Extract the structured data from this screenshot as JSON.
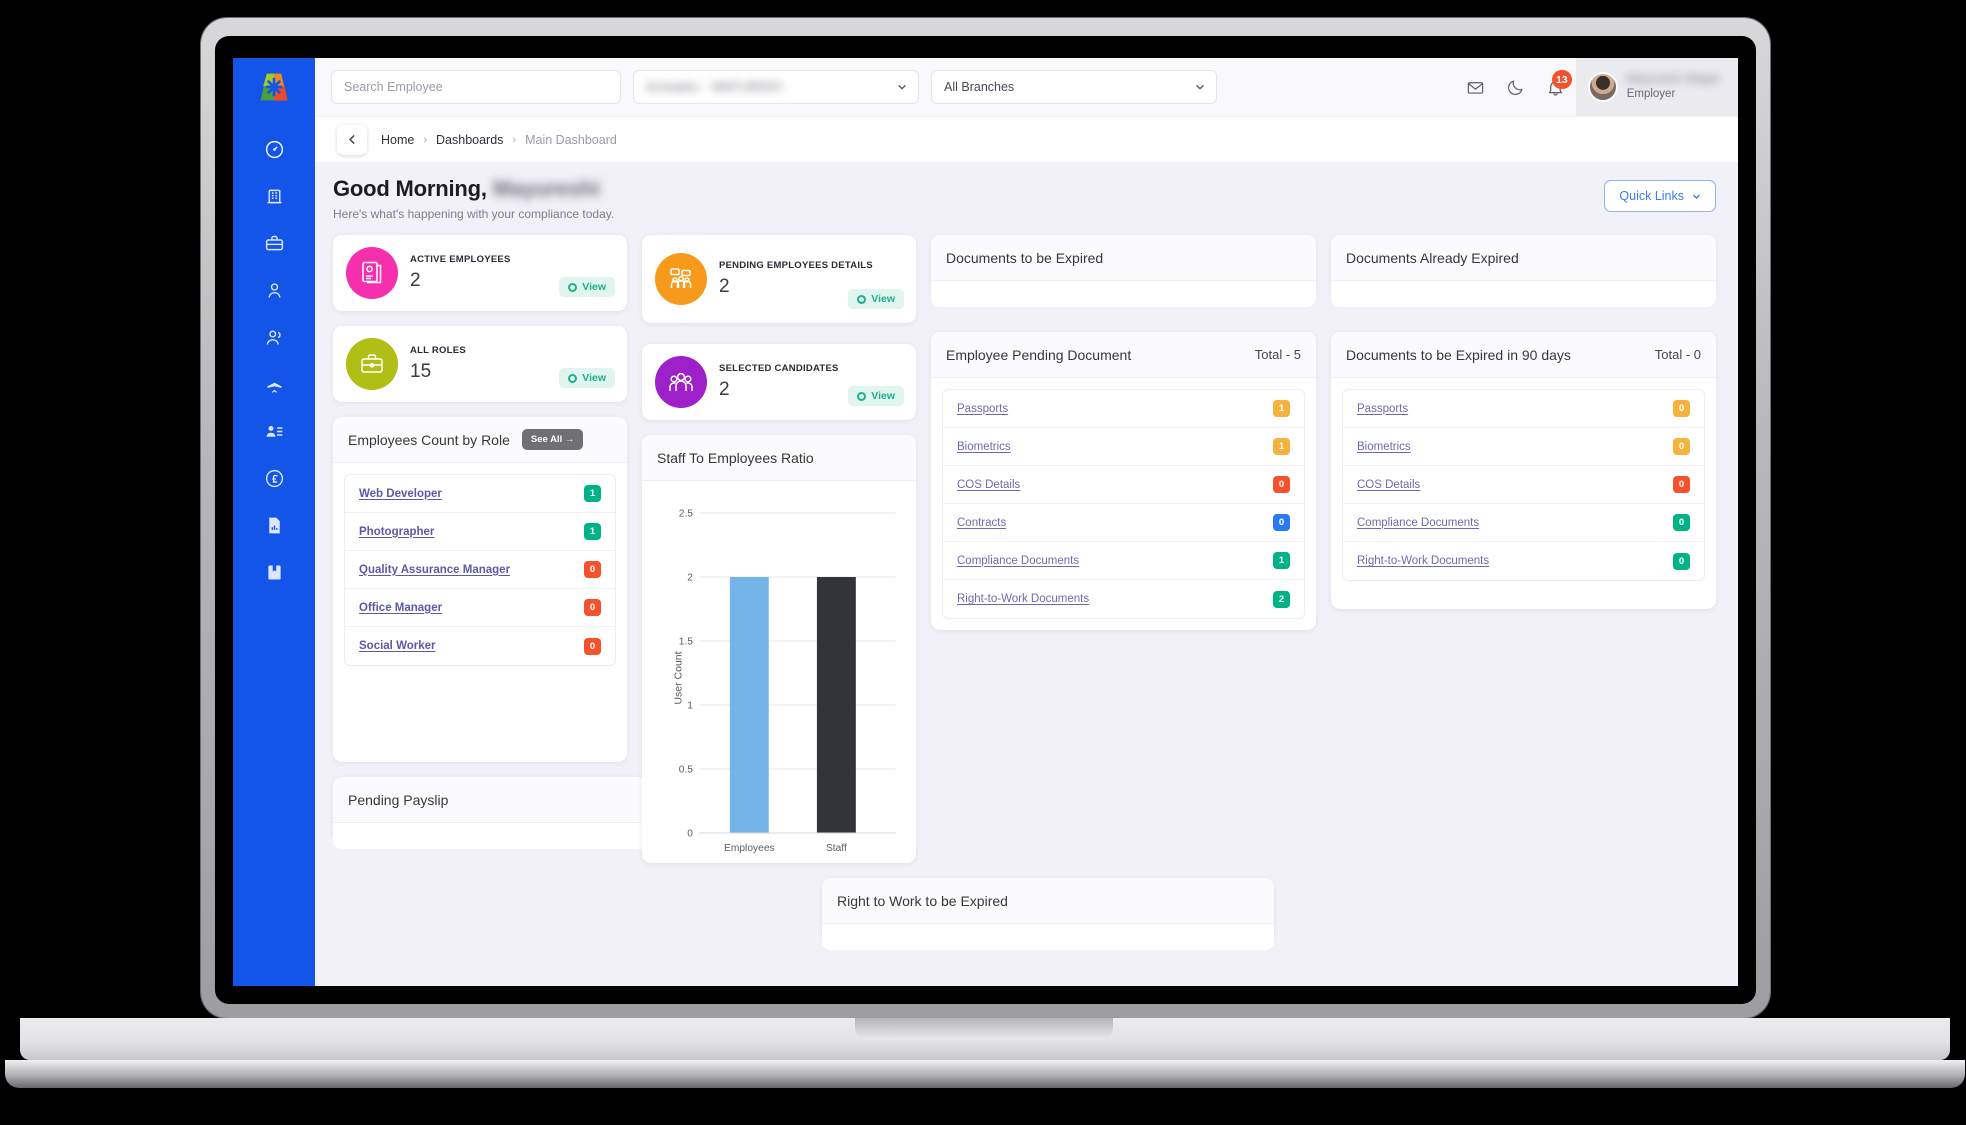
{
  "brand": {
    "logo_name": "app-logo",
    "sidebar_color": "#1355e9"
  },
  "topbar": {
    "search_placeholder": "Search Employee",
    "company_select": "Armadev - WATURDIH",
    "branch_select": "All Branches",
    "notification_count": "13",
    "user_name": "Mayureshi Wagar",
    "user_role": "Employer"
  },
  "breadcrumb": {
    "home": "Home",
    "section": "Dashboards",
    "current": "Main Dashboard",
    "sep": "›"
  },
  "greeting": {
    "salutation": "Good Morning,",
    "name": "Mayureshi",
    "subtitle": "Here's what's happening with your compliance today."
  },
  "quick_links": {
    "label": "Quick Links"
  },
  "stats": [
    {
      "label": "ACTIVE EMPLOYEES",
      "value": "2",
      "view": "View",
      "color": "#f62fae",
      "icon": "id-card-icon"
    },
    {
      "label": "PENDING EMPLOYEES DETAILS",
      "value": "2",
      "view": "View",
      "color": "#f79a1c",
      "icon": "meeting-icon"
    },
    {
      "label": "ALL ROLES",
      "value": "15",
      "view": "View",
      "color": "#b0bf15",
      "icon": "briefcase-icon"
    },
    {
      "label": "SELECTED CANDIDATES",
      "value": "2",
      "view": "View",
      "color": "#9d20c9",
      "icon": "group-icon"
    }
  ],
  "documents_to_be_expired": {
    "title": "Documents to be Expired"
  },
  "documents_already_expired": {
    "title": "Documents Already Expired"
  },
  "roles_panel": {
    "title": "Employees Count by Role",
    "see_all": "See All →",
    "rows": [
      {
        "label": "Web Developer",
        "count": "1",
        "color": "#00b386"
      },
      {
        "label": "Photographer",
        "count": "1",
        "color": "#00b386"
      },
      {
        "label": "Quality Assurance Manager",
        "count": "0",
        "color": "#f4512c"
      },
      {
        "label": "Office Manager",
        "count": "0",
        "color": "#f4512c"
      },
      {
        "label": "Social Worker",
        "count": "0",
        "color": "#f4512c"
      }
    ]
  },
  "pending_documents": {
    "title": "Employee Pending Document",
    "total": "Total - 5",
    "rows": [
      {
        "label": "Passports",
        "count": "1",
        "color": "#f5b23c"
      },
      {
        "label": "Biometrics",
        "count": "1",
        "color": "#f5b23c"
      },
      {
        "label": "COS Details",
        "count": "0",
        "color": "#f4512c"
      },
      {
        "label": "Contracts",
        "count": "0",
        "color": "#2979f2"
      },
      {
        "label": "Compliance Documents",
        "count": "1",
        "color": "#00b386"
      },
      {
        "label": "Right-to-Work Documents",
        "count": "2",
        "color": "#00b386"
      }
    ]
  },
  "expiring_90_days": {
    "title": "Documents to be Expired in 90 days",
    "total": "Total - 0",
    "rows": [
      {
        "label": "Passports",
        "count": "0",
        "color": "#f5b23c"
      },
      {
        "label": "Biometrics",
        "count": "0",
        "color": "#f5b23c"
      },
      {
        "label": "COS Details",
        "count": "0",
        "color": "#f4512c"
      },
      {
        "label": "Compliance Documents",
        "count": "0",
        "color": "#00b386"
      },
      {
        "label": "Right-to-Work Documents",
        "count": "0",
        "color": "#00b386"
      }
    ]
  },
  "pending_payslip": {
    "title": "Pending Payslip"
  },
  "rtw_expired": {
    "title": "Right to Work to be Expired"
  },
  "sidebar": {
    "items": [
      {
        "name": "dashboard",
        "icon": "speedometer-icon",
        "active": true
      },
      {
        "name": "company",
        "icon": "building-icon",
        "active": false
      },
      {
        "name": "jobs",
        "icon": "briefcase-icon",
        "active": false
      },
      {
        "name": "employee",
        "icon": "user-icon",
        "active": false
      },
      {
        "name": "teams",
        "icon": "users-icon",
        "active": false
      },
      {
        "name": "travel",
        "icon": "airplane-icon",
        "active": false
      },
      {
        "name": "candidates",
        "icon": "user-list-icon",
        "active": false
      },
      {
        "name": "payroll",
        "icon": "pound-circle-icon",
        "active": false
      },
      {
        "name": "reports",
        "icon": "document-chart-icon",
        "active": false
      },
      {
        "name": "archive",
        "icon": "bookmark-save-icon",
        "active": false
      }
    ]
  },
  "chart_data": {
    "type": "bar",
    "title": "Staff To Employees Ratio",
    "categories": [
      "Employees",
      "Staff"
    ],
    "values": [
      2,
      2
    ],
    "colors": [
      "#74b4e8",
      "#33333a"
    ],
    "xlabel": "",
    "ylabel": "User Count",
    "ylim": [
      0,
      2.5
    ],
    "yticks": [
      "0",
      "0.5",
      "1",
      "1.5",
      "2",
      "2.5"
    ],
    "grid": true,
    "legend": "none"
  }
}
